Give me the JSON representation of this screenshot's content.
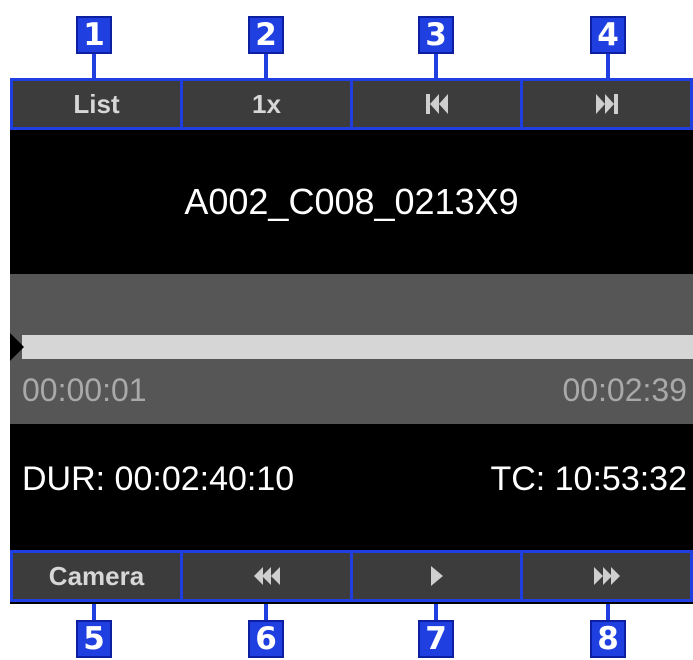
{
  "callouts": {
    "top": [
      "1",
      "2",
      "3",
      "4"
    ],
    "bottom": [
      "5",
      "6",
      "7",
      "8"
    ]
  },
  "top_bar": {
    "list_label": "List",
    "speed_label": "1x",
    "prev_icon": "skip-previous-icon",
    "next_icon": "skip-next-icon"
  },
  "clip": {
    "name": "A002_C008_0213X9"
  },
  "timeline": {
    "start": "00:00:01",
    "end": "00:02:39",
    "progress": 0.0
  },
  "info": {
    "duration": "DUR: 00:02:40:10",
    "timecode": "TC: 10:53:32"
  },
  "bottom_bar": {
    "camera_label": "Camera",
    "rewind_icon": "rewind-icon",
    "play_icon": "play-icon",
    "fast_forward_icon": "fast-forward-icon"
  },
  "colors": {
    "accent": "#1f3fe0",
    "button_bg": "#3c3c3c",
    "timeline_bg": "#565656",
    "screen_bg": "#000000"
  }
}
